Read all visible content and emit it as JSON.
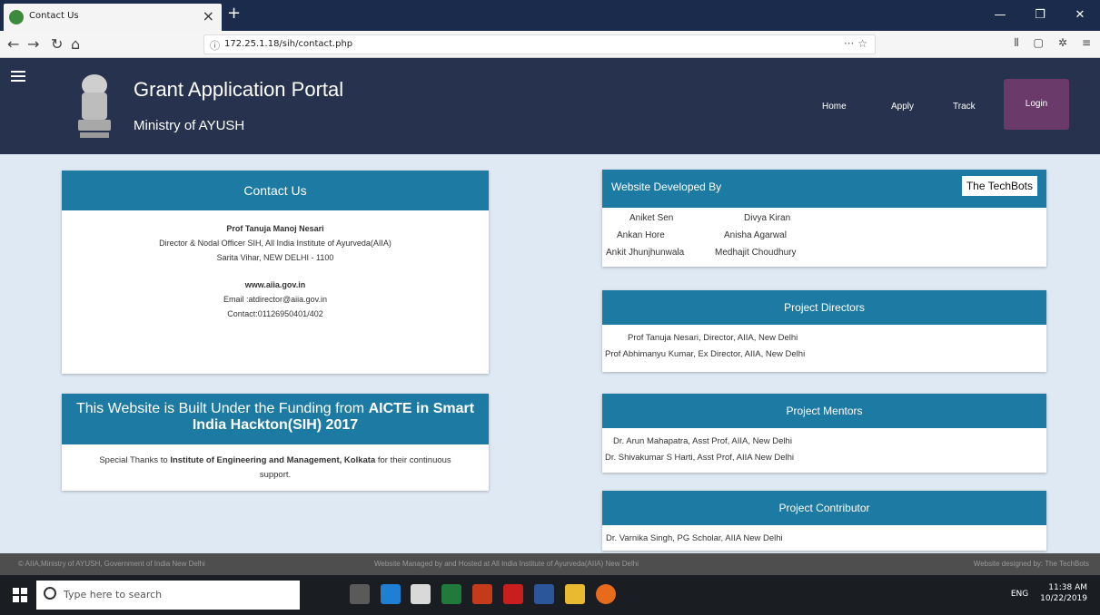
{
  "browser": {
    "tab_title": "Contact Us",
    "url": "172.25.1.18/sih/contact.php",
    "tab_close": "×",
    "new_tab": "+"
  },
  "header": {
    "title": "Grant Application Portal",
    "subtitle": "Ministry of AYUSH",
    "nav": [
      "Home",
      "Apply",
      "Track"
    ],
    "login": "Login"
  },
  "contact": {
    "heading": "Contact Us",
    "name": "Prof Tanuja Manoj Nesari",
    "role": "Director & Nodal Officer SIH, All India Institute of Ayurveda(AIIA)",
    "address": "Sarita Vihar, NEW DELHI - 1100",
    "website": "www.aiia.gov.in",
    "email": "Email :atdirector@aiia.gov.in",
    "phone": "Contact:01126950401/402"
  },
  "funding": {
    "heading_part1": "This Website is Built Under the Funding from ",
    "heading_bold": "AICTE in Smart India Hackton(SIH) 2017",
    "thanks_pre": "Special Thanks to ",
    "thanks_bold": "Institute of Engineering and Management, Kolkata",
    "thanks_post": " for their continuous support."
  },
  "developers": {
    "heading": "Website Developed By",
    "badge": "The TechBots",
    "names": [
      "Aniket Sen",
      "Divya Kiran",
      "Ankan Hore",
      "Anisha Agarwal",
      "Ankit Jhunjhunwala",
      "Medhajit Choudhury"
    ]
  },
  "directors": {
    "heading": "Project Directors",
    "items": [
      "Prof Tanuja Nesari, Director, AIIA, New Delhi",
      "Prof Abhimanyu Kumar, Ex Director, AIIA, New Delhi"
    ]
  },
  "mentors": {
    "heading": "Project Mentors",
    "items": [
      "Dr. Arun Mahapatra, Asst Prof, AIIA, New Delhi",
      "Dr. Shivakumar S Harti, Asst Prof, AIIA New Delhi"
    ]
  },
  "contributor": {
    "heading": "Project Contributor",
    "items": [
      "Dr. Varnika Singh, PG Scholar, AIIA New Delhi"
    ]
  },
  "footer": {
    "left": "© AIIA,Ministry of AYUSH, Government of India New Delhi",
    "center": "Website Managed by and Hosted at All India Institute of Ayurveda(AIIA) New Delhi",
    "right": "Website designed by: The TechBots"
  },
  "taskbar": {
    "search_placeholder": "Type here to search",
    "time": "11:38 AM",
    "date": "10/22/2019",
    "lang": "ENG"
  },
  "colors": {
    "header_bg": "#27334e",
    "card_head": "#1c7aa3",
    "login_bg": "#6a3a6a",
    "page_bg": "#dfe9f3"
  }
}
